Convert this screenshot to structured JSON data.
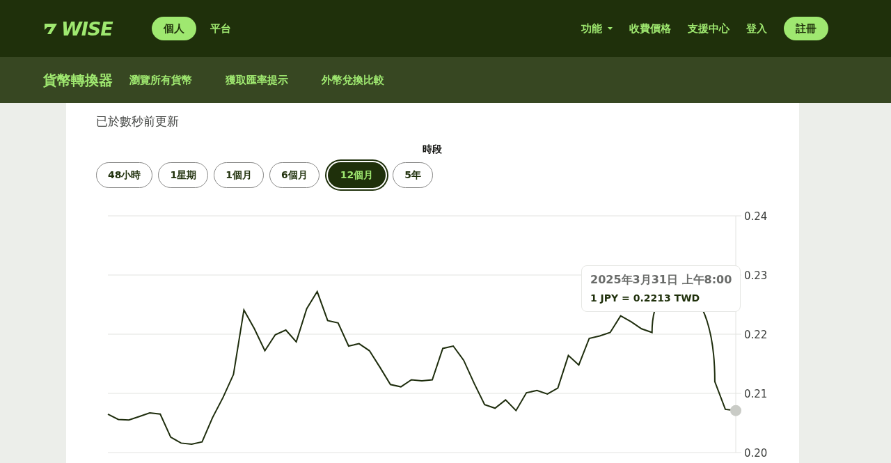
{
  "header": {
    "logo": "WISE",
    "segments": [
      {
        "label": "個人",
        "selected": true
      },
      {
        "label": "平台",
        "selected": false
      }
    ],
    "nav": [
      {
        "label": "功能",
        "kind": "dropdown"
      },
      {
        "label": "收費價格",
        "kind": "link"
      },
      {
        "label": "支援中心",
        "kind": "link"
      },
      {
        "label": "登入",
        "kind": "link"
      },
      {
        "label": "註冊",
        "kind": "button"
      }
    ]
  },
  "subnav": {
    "title": "貨幣轉換器",
    "links": [
      "瀏覽所有貨幣",
      "獲取匯率提示",
      "外幣兌換比較"
    ]
  },
  "updated": "已於數秒前更新",
  "period": {
    "label": "時段",
    "options": [
      {
        "label": "48小時",
        "selected": false
      },
      {
        "label": "1星期",
        "selected": false
      },
      {
        "label": "1個月",
        "selected": false
      },
      {
        "label": "6個月",
        "selected": false
      },
      {
        "label": "12個月",
        "selected": true
      },
      {
        "label": "5年",
        "selected": false
      }
    ]
  },
  "chart": {
    "tooltip": {
      "date": "2025年3月31日 上午8:00",
      "rate": "1 JPY = 0.2213 TWD"
    },
    "chart_data": {
      "type": "line",
      "grid": true,
      "ylim": [
        0.2,
        0.24
      ],
      "yticks": [
        {
          "value": 0.2,
          "label": "0.20"
        },
        {
          "value": 0.21,
          "label": "0.21"
        },
        {
          "value": 0.22,
          "label": "0.22"
        },
        {
          "value": 0.23,
          "label": "0.23"
        },
        {
          "value": 0.24,
          "label": "0.24"
        }
      ],
      "series": [
        {
          "color": "#1e2d0d",
          "values": [
            0.2065,
            0.2056,
            0.2055,
            0.2061,
            0.2067,
            0.2065,
            0.2026,
            0.2016,
            0.2014,
            0.2018,
            0.2059,
            0.2093,
            0.2132,
            0.2241,
            0.2209,
            0.2172,
            0.2199,
            0.2207,
            0.2187,
            0.2243,
            0.2272,
            0.2223,
            0.2219,
            0.218,
            0.2184,
            0.2172,
            0.2144,
            0.2115,
            0.2111,
            0.2123,
            0.2121,
            0.2123,
            0.2176,
            0.218,
            0.2156,
            0.2117,
            0.2081,
            0.2075,
            0.2089,
            0.2071,
            0.2101,
            0.2105,
            0.2099,
            0.2109,
            0.2164,
            0.2148,
            0.2193,
            0.2197,
            0.2203,
            0.2231,
            0.2221,
            0.2209,
            0.2203,
            null,
            null,
            null,
            null,
            null,
            0.212,
            0.2073,
            0.2071
          ]
        }
      ]
    }
  }
}
